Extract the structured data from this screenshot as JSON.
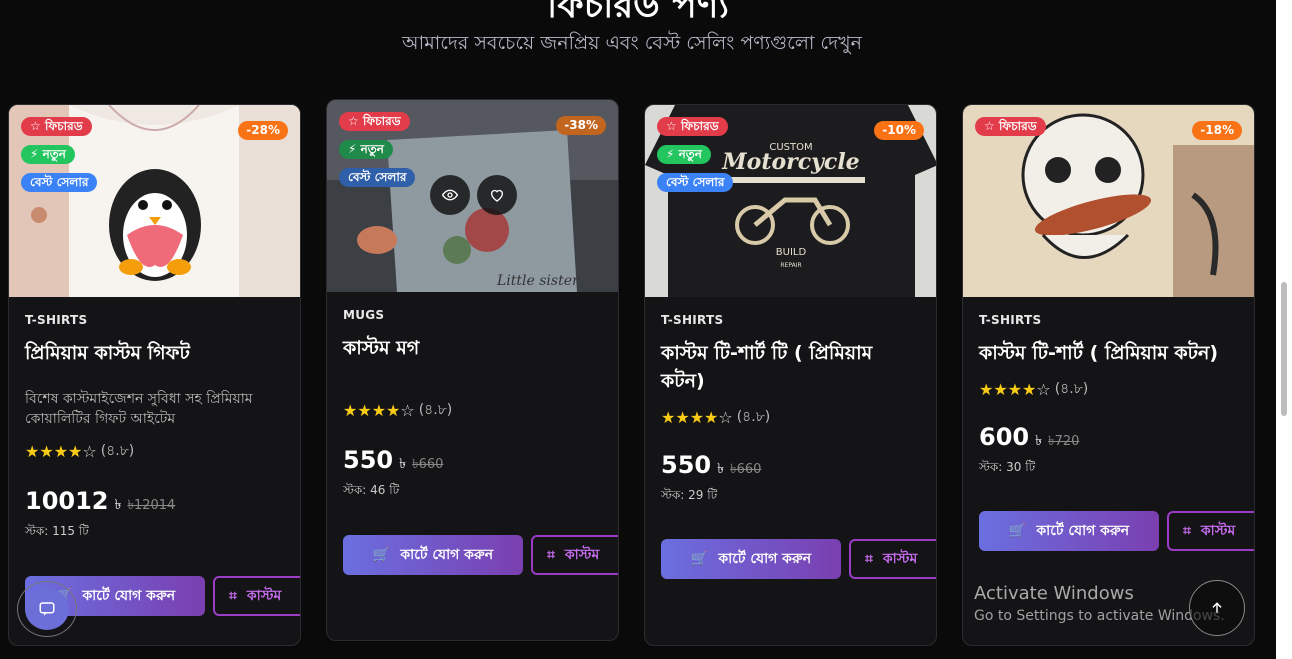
{
  "section": {
    "title": "ফিচারড পণ্য",
    "subtitle": "আমাদের সবচেয়ে জনপ্রিয় এবং বেস্ট সেলিং পণ্যগুলো দেখুন"
  },
  "badges": {
    "featured": "ফিচারড",
    "new": "নতুন",
    "best": "বেস্ট সেলার"
  },
  "buttons": {
    "cart": "কার্টে যোগ করুন",
    "custom": "কাস্টম"
  },
  "products": [
    {
      "discount": "-28%",
      "category": "T-SHIRTS",
      "name": "প্রিমিয়াম কাস্টম গিফট",
      "description": "বিশেষ কাস্টমাইজেশন সুবিধা সহ প্রিমিয়াম কোয়ালিটির গিফট আইটেম",
      "rating": "(৪.৮)",
      "price": "10012",
      "currency": "৳",
      "old_price": "৳12014",
      "stock": "স্টক: 115 টি"
    },
    {
      "discount": "-38%",
      "category": "MUGS",
      "name": "কাস্টম মগ",
      "description": "",
      "rating": "(৪.৮)",
      "price": "550",
      "currency": "৳",
      "old_price": "৳660",
      "stock": "স্টক: 46 টি",
      "mug_text": "Little sister"
    },
    {
      "discount": "-10%",
      "category": "T-SHIRTS",
      "name": "কাস্টম টি-শার্ট টি ( প্রিমিয়াম কটন)",
      "description": "",
      "rating": "(৪.৮)",
      "price": "550",
      "currency": "৳",
      "old_price": "৳660",
      "stock": "স্টক: 29 টি",
      "shirt_text": {
        "top": "CUSTOM",
        "main": "Motorcycle",
        "bottom": "BUILD",
        "sub": "REPAIR"
      }
    },
    {
      "discount": "-18%",
      "category": "T-SHIRTS",
      "name": "কাস্টম টি-শার্ট ( প্রিমিয়াম কটন)",
      "description": "",
      "rating": "(৪.৮)",
      "price": "600",
      "currency": "৳",
      "old_price": "৳720",
      "stock": "স্টক: 30 টি"
    }
  ],
  "overlay": {
    "windows_title": "Activate Windows",
    "windows_sub": "Go to Settings to activate Windows."
  },
  "colors": {
    "background": "#0a0a0a",
    "card": "#141416",
    "featured_badge": "#e23c4a",
    "new_badge": "#22c55e",
    "best_badge": "#3b82f6",
    "discount": "#f97316",
    "cart_gradient_start": "#6b6fe0",
    "cart_gradient_end": "#7a3fb0",
    "custom_border": "#9b3cc7",
    "star": "#facc15"
  }
}
